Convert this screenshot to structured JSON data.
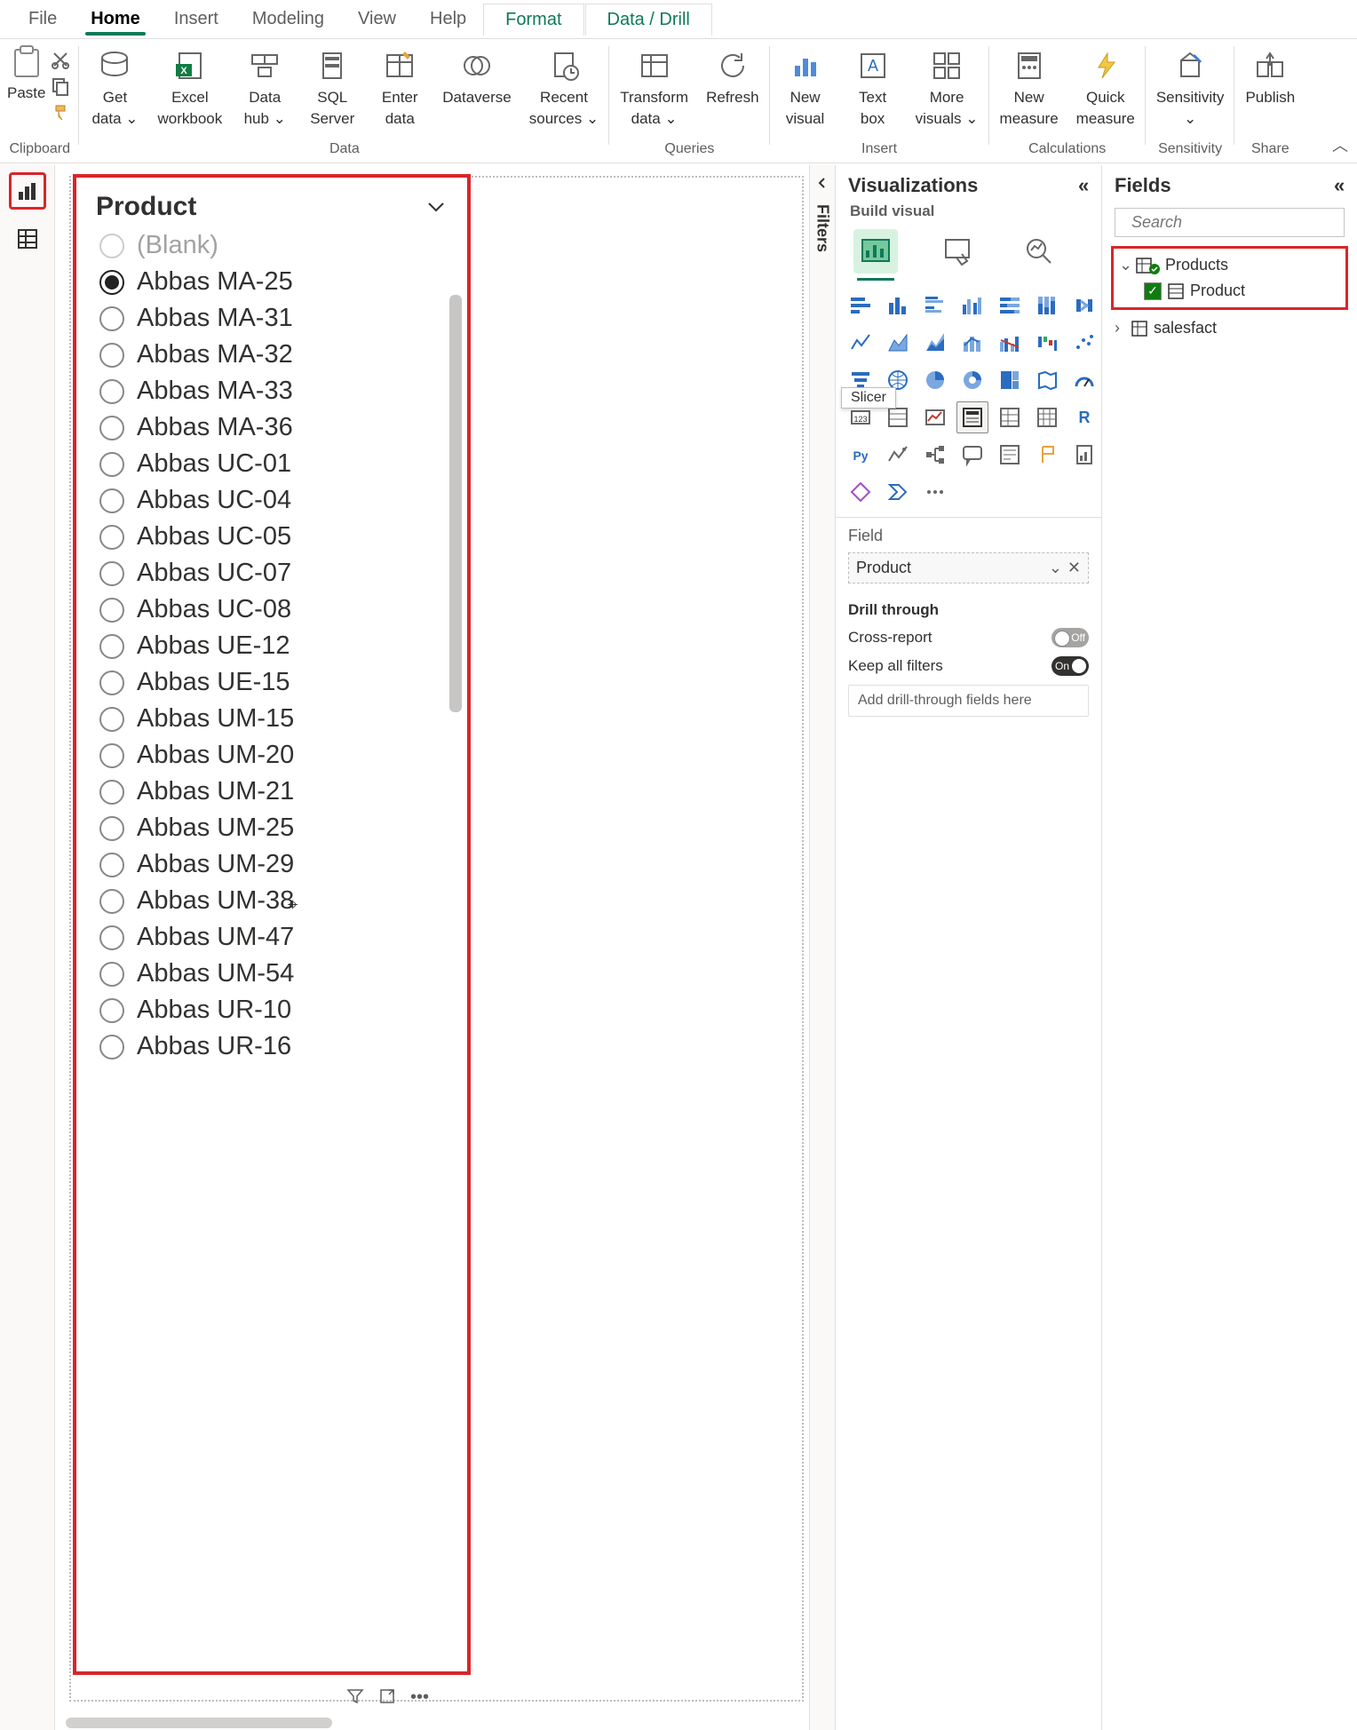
{
  "tabs": {
    "file": "File",
    "home": "Home",
    "insert": "Insert",
    "modeling": "Modeling",
    "view": "View",
    "help": "Help",
    "format": "Format",
    "data_drill": "Data / Drill"
  },
  "ribbon": {
    "clipboard": {
      "paste": "Paste",
      "group": "Clipboard"
    },
    "data": {
      "get_data_top": "Get",
      "get_data_bot": "data ⌄",
      "excel_top": "Excel",
      "excel_bot": "workbook",
      "datahub_top": "Data",
      "datahub_bot": "hub ⌄",
      "sql_top": "SQL",
      "sql_bot": "Server",
      "enter_top": "Enter",
      "enter_bot": "data",
      "dataverse": "Dataverse",
      "recent_top": "Recent",
      "recent_bot": "sources ⌄",
      "group": "Data"
    },
    "queries": {
      "transform_top": "Transform",
      "transform_bot": "data ⌄",
      "refresh": "Refresh",
      "group": "Queries"
    },
    "insert": {
      "new_visual_top": "New",
      "new_visual_bot": "visual",
      "text_top": "Text",
      "text_bot": "box",
      "more_top": "More",
      "more_bot": "visuals ⌄",
      "group": "Insert"
    },
    "calc": {
      "new_measure_top": "New",
      "new_measure_bot": "measure",
      "quick_top": "Quick",
      "quick_bot": "measure",
      "group": "Calculations"
    },
    "sensitivity": {
      "label": "Sensitivity",
      "dropdown": "⌄",
      "group": "Sensitivity"
    },
    "share": {
      "publish": "Publish",
      "group": "Share"
    }
  },
  "filters_label": "Filters",
  "viz": {
    "title": "Visualizations",
    "build": "Build visual",
    "tooltip": "Slicer",
    "field_label": "Field",
    "field_value": "Product",
    "drill_title": "Drill through",
    "cross_report": "Cross-report",
    "keep_filters": "Keep all filters",
    "off": "Off",
    "on": "On",
    "drill_placeholder": "Add drill-through fields here"
  },
  "fields": {
    "title": "Fields",
    "search_placeholder": "Search",
    "table1": "Products",
    "col1": "Product",
    "table2": "salesfact"
  },
  "slicer": {
    "title": "Product",
    "items": [
      {
        "label": "(Blank)",
        "blank": true,
        "selected": false
      },
      {
        "label": "Abbas MA-25",
        "selected": true
      },
      {
        "label": "Abbas MA-31",
        "selected": false
      },
      {
        "label": "Abbas MA-32",
        "selected": false
      },
      {
        "label": "Abbas MA-33",
        "selected": false
      },
      {
        "label": "Abbas MA-36",
        "selected": false
      },
      {
        "label": "Abbas UC-01",
        "selected": false
      },
      {
        "label": "Abbas UC-04",
        "selected": false
      },
      {
        "label": "Abbas UC-05",
        "selected": false
      },
      {
        "label": "Abbas UC-07",
        "selected": false
      },
      {
        "label": "Abbas UC-08",
        "selected": false
      },
      {
        "label": "Abbas UE-12",
        "selected": false
      },
      {
        "label": "Abbas UE-15",
        "selected": false
      },
      {
        "label": "Abbas UM-15",
        "selected": false
      },
      {
        "label": "Abbas UM-20",
        "selected": false
      },
      {
        "label": "Abbas UM-21",
        "selected": false
      },
      {
        "label": "Abbas UM-25",
        "selected": false
      },
      {
        "label": "Abbas UM-29",
        "selected": false
      },
      {
        "label": "Abbas UM-38",
        "selected": false
      },
      {
        "label": "Abbas UM-47",
        "selected": false
      },
      {
        "label": "Abbas UM-54",
        "selected": false
      },
      {
        "label": "Abbas UR-10",
        "selected": false
      },
      {
        "label": "Abbas UR-16",
        "selected": false
      }
    ]
  }
}
